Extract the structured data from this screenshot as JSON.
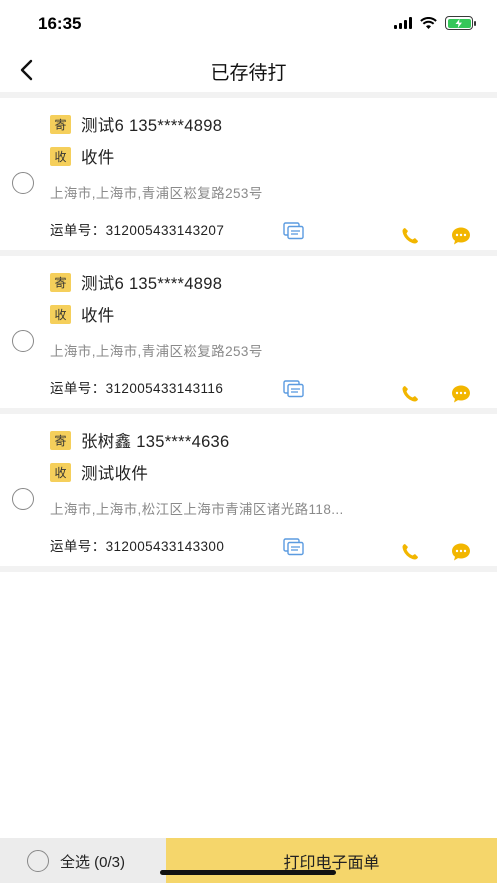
{
  "status_bar": {
    "time": "16:35"
  },
  "nav": {
    "title": "已存待打"
  },
  "tags": {
    "sender": "寄",
    "receiver": "收"
  },
  "waybill_prefix": "运单号：",
  "orders": [
    {
      "sender_line": "测试6  135****4898",
      "receiver_line": "收件",
      "address": "上海市,上海市,青浦区崧复路253号",
      "waybill": "312005433143207"
    },
    {
      "sender_line": "测试6  135****4898",
      "receiver_line": "收件",
      "address": "上海市,上海市,青浦区崧复路253号",
      "waybill": "312005433143116"
    },
    {
      "sender_line": "张树鑫  135****4636",
      "receiver_line": "测试收件",
      "address": "上海市,上海市,松江区上海市青浦区诸光路118...",
      "waybill": "312005433143300"
    }
  ],
  "bottom": {
    "select_all": "全选 (0/3)",
    "print_button": "打印电子面单"
  },
  "colors": {
    "accent": "#f5cf5b",
    "print_bg": "#f5d66b",
    "icon_blue": "#5b9be0",
    "icon_yellow": "#f2b600"
  }
}
